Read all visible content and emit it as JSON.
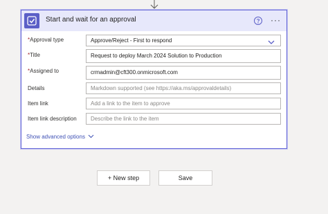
{
  "card": {
    "title": "Start and wait for an approval",
    "icons": {
      "app": "approval-icon",
      "help": "help-icon",
      "more": "more-options-icon",
      "connector": "down-arrow-icon"
    },
    "more_label": "···"
  },
  "fields": {
    "approval_type": {
      "label": "Approval type",
      "required_mark": "*",
      "value": "Approve/Reject - First to respond"
    },
    "title": {
      "label": "Title",
      "required_mark": "*",
      "value": "Request to deploy March 2024 Solution to Production"
    },
    "assigned_to": {
      "label": "Assigned to",
      "required_mark": "*",
      "value": "crmadmin@cft300.onmicrosoft.com"
    },
    "details": {
      "label": "Details",
      "placeholder": "Markdown supported (see https://aka.ms/approvaldetails)"
    },
    "item_link": {
      "label": "Item link",
      "placeholder": "Add a link to the item to approve"
    },
    "item_link_description": {
      "label": "Item link description",
      "placeholder": "Describe the link to the item"
    }
  },
  "advanced_options_label": "Show advanced options",
  "buttons": {
    "new_step": "+ New step",
    "save": "Save"
  },
  "colors": {
    "accent": "#5b5fc7",
    "header_bg": "#e7e8fb",
    "link": "#3f51b5",
    "required": "#a4262c"
  }
}
